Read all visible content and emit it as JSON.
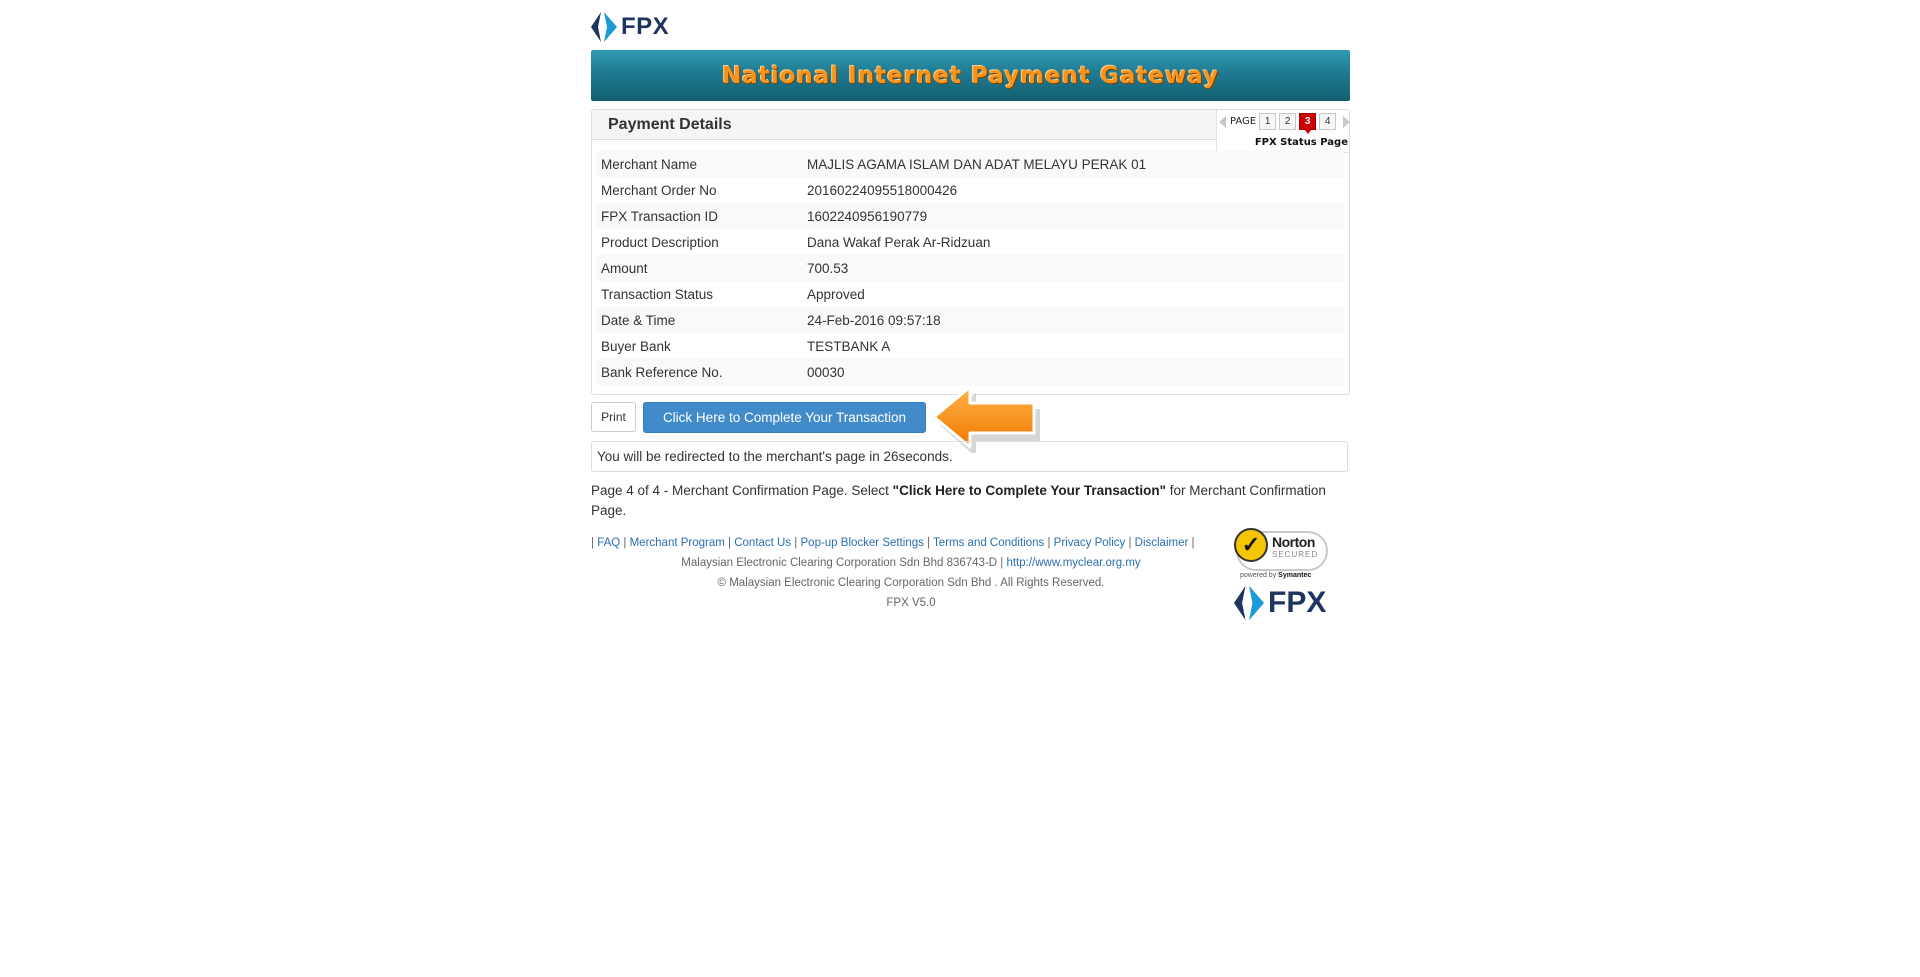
{
  "brand": {
    "logo_text": "FPX",
    "banner_title": "National Internet Payment Gateway"
  },
  "panel": {
    "title": "Payment Details"
  },
  "pager": {
    "label": "PAGE",
    "pages": [
      "1",
      "2",
      "3",
      "4"
    ],
    "current_page": 3,
    "caption": "FPX Status Page"
  },
  "details": [
    {
      "label": "Merchant Name",
      "value": "MAJLIS AGAMA ISLAM DAN ADAT MELAYU PERAK 01"
    },
    {
      "label": "Merchant Order No",
      "value": "20160224095518000426"
    },
    {
      "label": "FPX Transaction ID",
      "value": "1602240956190779"
    },
    {
      "label": "Product Description",
      "value": "Dana Wakaf Perak Ar-Ridzuan"
    },
    {
      "label": "Amount",
      "value": "700.53"
    },
    {
      "label": "Transaction Status",
      "value": "Approved"
    },
    {
      "label": "Date & Time",
      "value": "24-Feb-2016 09:57:18"
    },
    {
      "label": "Buyer Bank",
      "value": "TESTBANK A"
    },
    {
      "label": "Bank Reference No.",
      "value": "00030"
    }
  ],
  "actions": {
    "print_label": "Print",
    "complete_label": "Click Here to Complete Your Transaction"
  },
  "redirect": {
    "prefix": "You will be redirected to the merchant's page in ",
    "seconds": "26",
    "suffix": " seconds."
  },
  "note": {
    "part1": "Page 4 of 4 - Merchant Confirmation Page. Select ",
    "bold": "\"Click Here to Complete Your Transaction\"",
    "part2": " for Merchant Confirmation Page."
  },
  "footer": {
    "links": [
      "FAQ",
      "Merchant Program",
      "Contact Us",
      "Pop-up Blocker Settings",
      "Terms and Conditions",
      "Privacy Policy",
      "Disclaimer"
    ],
    "company_line": "Malaysian Electronic Clearing Corporation Sdn Bhd 836743-D | ",
    "company_url": "http://www.myclear.org.my",
    "copyright": "© Malaysian Electronic Clearing Corporation Sdn Bhd . All Rights Reserved.",
    "version": "FPX V5.0"
  },
  "norton": {
    "name": "Norton",
    "secured": "SECURED",
    "powered_by": "powered by",
    "company": "Symantec"
  },
  "colors": {
    "banner": "#1f7a92",
    "banner_text": "#f7941d",
    "button_primary": "#428bca",
    "active_page": "#cc0000",
    "link": "#2a6fb0",
    "arrow": "#f7941d"
  }
}
